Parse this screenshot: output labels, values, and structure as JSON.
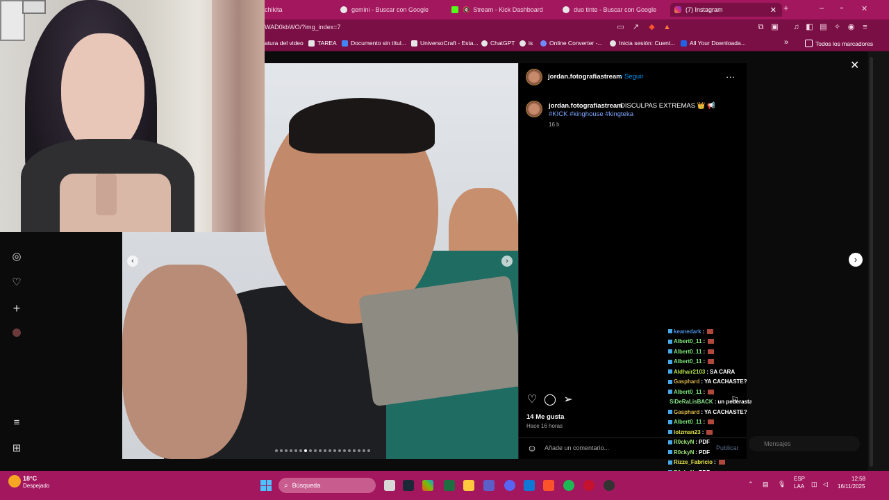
{
  "browser": {
    "tabs": [
      {
        "label": "chikita",
        "active": false
      },
      {
        "label": "gemini - Buscar con Google",
        "active": false
      },
      {
        "label": "Stream - Kick Dashboard",
        "active": false
      },
      {
        "label": "duo tinte - Buscar con Google",
        "active": false
      },
      {
        "label": "(7) Instagram",
        "active": true
      }
    ],
    "url": "WAD0kbWO/?img_index=7",
    "bookmarks": [
      "atura del video",
      "TAREA",
      "Documento sin títul...",
      "UniversoCraft - Esta...",
      "ChatGPT",
      "is",
      "Online Converter -...",
      "Inicia sesión: Cuent...",
      "All Your Downloada..."
    ],
    "bookmarks_more": "»",
    "all_bookmarks": "Todos los marcadores"
  },
  "post": {
    "username": "jordan.fotografiastream",
    "follow": "Seguir",
    "caption": "DISCULPAS EXTREMAS 👑 📢",
    "hashtags": "#KICK #kinghouse #kingteka",
    "time": "16 h",
    "likes": "14 Me gusta",
    "posted": "Hace 16 horas",
    "comment_placeholder": "Añade un comentario...",
    "publish": "Publicar",
    "more_icon": "···"
  },
  "chat": [
    {
      "user": "keanedark",
      "msg": "",
      "color": "#4a90e2"
    },
    {
      "user": "Albert0_11",
      "msg": "",
      "color": "#7be57b"
    },
    {
      "user": "Albert0_11",
      "msg": "",
      "color": "#7be57b"
    },
    {
      "user": "Albert0_11",
      "msg": "",
      "color": "#7be57b"
    },
    {
      "user": "Aldhair2103",
      "msg": "SA CARA",
      "color": "#b7e24a"
    },
    {
      "user": "Gasphard",
      "msg": "YA CACHASTE?",
      "color": "#d8b44a"
    },
    {
      "user": "Albert0_11",
      "msg": "",
      "color": "#7be57b"
    },
    {
      "user": "SiDeRaLisBACK",
      "msg": "un pederasta",
      "color": "#8ae58a"
    },
    {
      "user": "Gasphard",
      "msg": "YA CACHASTE?",
      "color": "#d8b44a"
    },
    {
      "user": "Albert0_11",
      "msg": "",
      "color": "#7be57b"
    },
    {
      "user": "lolzman23",
      "msg": "",
      "color": "#e5e54a"
    },
    {
      "user": "R0ckyN",
      "msg": "PDF",
      "color": "#9de57b"
    },
    {
      "user": "R0ckyN",
      "msg": "PDF",
      "color": "#9de57b"
    },
    {
      "user": "Rizze_Fabricio",
      "msg": "",
      "color": "#e5e54a"
    },
    {
      "user": "R0ckyN",
      "msg": "PDF",
      "color": "#9de57b"
    }
  ],
  "messages_label": "Mensajes",
  "taskbar": {
    "weather_temp": "18°C",
    "weather_desc": "Despejado",
    "search": "Búsqueda",
    "lang1": "ESP",
    "lang2": "LAA",
    "time": "12:58",
    "date": "16/11/2025"
  },
  "colors": {
    "accent": "#a3175e",
    "link": "#0095f6"
  }
}
